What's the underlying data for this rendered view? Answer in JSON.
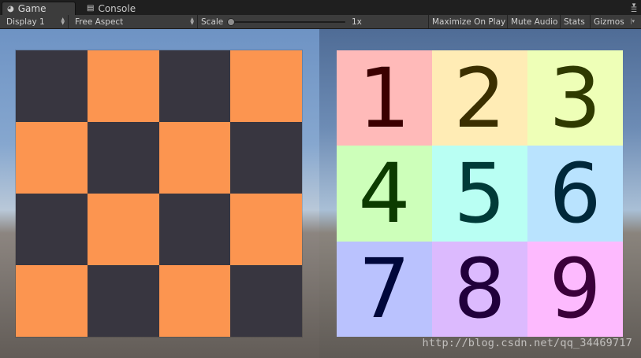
{
  "tabs": [
    {
      "label": "Game",
      "icon": "pacman-icon",
      "active": true
    },
    {
      "label": "Console",
      "icon": "console-icon",
      "active": false
    }
  ],
  "toolbar": {
    "display": "Display 1",
    "aspect": "Free Aspect",
    "scale_label": "Scale",
    "scale_value": "1x",
    "scale_level": 0,
    "maximize_on_play": "Maximize On Play",
    "mute_audio": "Mute Audio",
    "stats": "Stats",
    "gizmos": "Gizmos"
  },
  "colors": {
    "checker_dark": "#383640",
    "checker_light": "#fc9550"
  },
  "checkerboard": {
    "rows": [
      [
        "dark",
        "light",
        "dark",
        "light"
      ],
      [
        "light",
        "dark",
        "light",
        "dark"
      ],
      [
        "dark",
        "light",
        "dark",
        "light"
      ],
      [
        "light",
        "dark",
        "light",
        "dark"
      ]
    ]
  },
  "number_grid": {
    "cells": [
      {
        "label": "1",
        "bg": "#ffbab9",
        "fg": "#3b0000"
      },
      {
        "label": "2",
        "bg": "#ffecb5",
        "fg": "#3b2f00"
      },
      {
        "label": "3",
        "bg": "#eeffb7",
        "fg": "#2f3a00"
      },
      {
        "label": "4",
        "bg": "#cdffba",
        "fg": "#0c3b00"
      },
      {
        "label": "5",
        "bg": "#b9fff3",
        "fg": "#003b38"
      },
      {
        "label": "6",
        "bg": "#b9e3fe",
        "fg": "#00283a"
      },
      {
        "label": "7",
        "bg": "#bac2fe",
        "fg": "#00073b"
      },
      {
        "label": "8",
        "bg": "#dcbafe",
        "fg": "#21003b"
      },
      {
        "label": "9",
        "bg": "#fdbafe",
        "fg": "#3b003a"
      }
    ]
  },
  "watermark": "http://blog.csdn.net/qq_34469717"
}
